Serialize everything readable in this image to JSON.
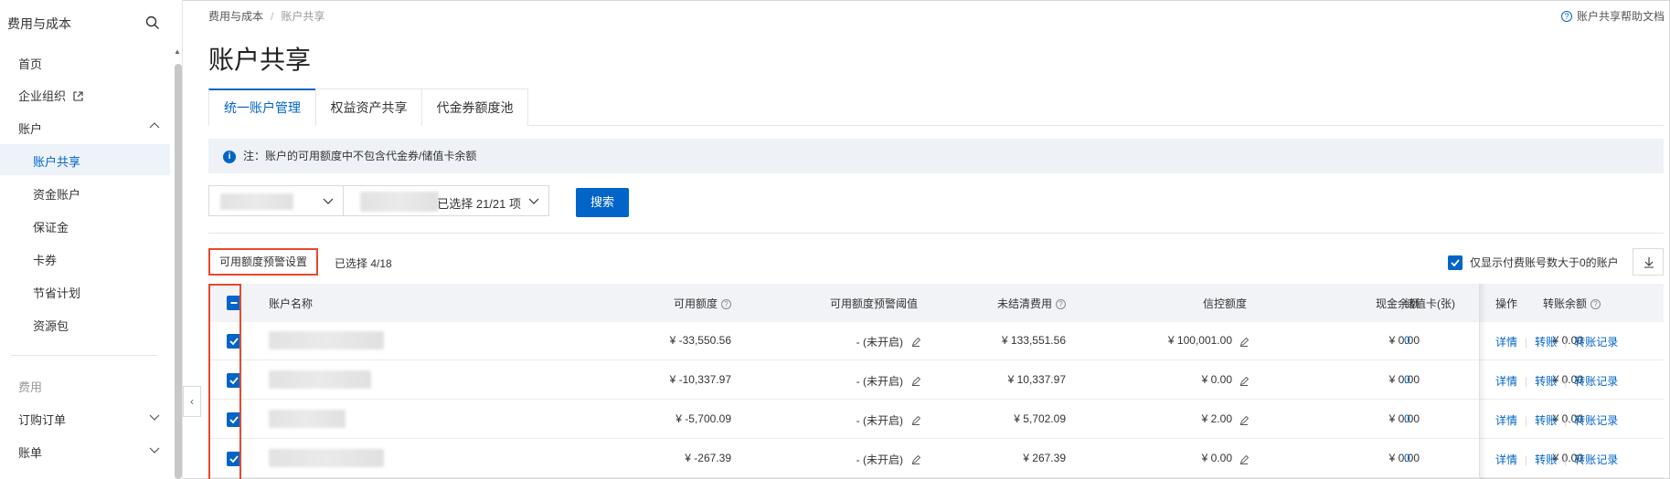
{
  "sidebar": {
    "title": "费用与成本",
    "items": [
      {
        "label": "首页"
      },
      {
        "label": "企业组织"
      },
      {
        "label": "账户"
      },
      {
        "label": "账户共享"
      },
      {
        "label": "资金账户"
      },
      {
        "label": "保证金"
      },
      {
        "label": "卡券"
      },
      {
        "label": "节省计划"
      },
      {
        "label": "资源包"
      }
    ],
    "group_label": "费用",
    "group_items": [
      {
        "label": "订购订单"
      },
      {
        "label": "账单"
      }
    ]
  },
  "breadcrumb": {
    "root": "费用与成本",
    "current": "账户共享"
  },
  "help_link": "账户共享帮助文档",
  "page_title": "账户共享",
  "tabs": [
    {
      "label": "统一账户管理",
      "active": true
    },
    {
      "label": "权益资产共享",
      "active": false
    },
    {
      "label": "代金券额度池",
      "active": false
    }
  ],
  "notice": "注：账户的可用额度中不包含代金券/储值卡余额",
  "filters": {
    "second_select_text": "已选择 21/21 项",
    "search_label": "搜索"
  },
  "toolbar": {
    "warn_setting_label": "可用额度预警设置",
    "selected_count": "已选择 4/18",
    "only_show_label": "仅显示付费账号数大于0的账户"
  },
  "table": {
    "headers": {
      "name": "账户名称",
      "available": "可用额度",
      "threshold": "可用额度预警阈值",
      "unsettled": "未结清费用",
      "credit": "信控额度",
      "cash": "现金余额",
      "transfer": "转账余额",
      "card": "储值卡(张)",
      "ops": "操作"
    },
    "rows": [
      {
        "available": "¥ -33,550.56",
        "threshold": "- (未开启)",
        "unsettled": "¥ 133,551.56",
        "credit": "¥ 100,001.00",
        "cash": "¥ 0.00",
        "transfer": "¥ 0.00",
        "card": "0"
      },
      {
        "available": "¥ -10,337.97",
        "threshold": "- (未开启)",
        "unsettled": "¥ 10,337.97",
        "credit": "¥ 0.00",
        "cash": "¥ 0.00",
        "transfer": "¥ 0.00",
        "card": "0"
      },
      {
        "available": "¥ -5,700.09",
        "threshold": "- (未开启)",
        "unsettled": "¥ 5,702.09",
        "credit": "¥ 2.00",
        "cash": "¥ 0.00",
        "transfer": "¥ 0.00",
        "card": "0"
      },
      {
        "available": "¥ -267.39",
        "threshold": "- (未开启)",
        "unsettled": "¥ 267.39",
        "credit": "¥ 0.00",
        "cash": "¥ 0.00",
        "transfer": "¥ 0.00",
        "card": "0"
      }
    ],
    "ops": {
      "detail": "详情",
      "transfer": "转账",
      "records": "转账记录"
    }
  }
}
